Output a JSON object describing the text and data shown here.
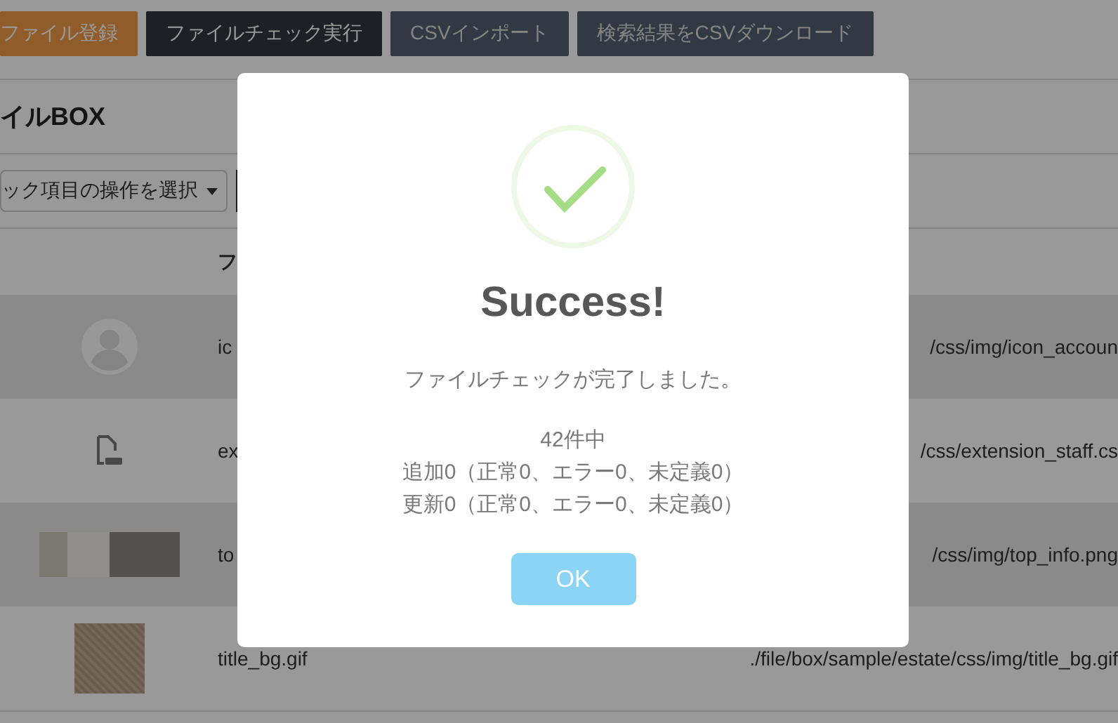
{
  "toolbar": {
    "buttons": [
      {
        "label": "ファイル登録",
        "kind": "accent"
      },
      {
        "label": "ファイルチェック実行",
        "kind": "dark"
      },
      {
        "label": "CSVインポート",
        "kind": "slate"
      },
      {
        "label": "検索結果をCSVダウンロード",
        "kind": "slate"
      }
    ]
  },
  "page_title": "イルBOX",
  "bulk_action": {
    "label": "ック項目の操作を選択"
  },
  "table": {
    "columns": [
      "フ"
    ],
    "rows": [
      {
        "kind": "avatar",
        "name": "ic",
        "path": "/css/img/icon_accoun"
      },
      {
        "kind": "css-file",
        "name": "ex",
        "path": "/css/extension_staff.cs"
      },
      {
        "kind": "photo",
        "name": "to",
        "path": "/css/img/top_info.png"
      },
      {
        "kind": "texture",
        "name": "title_bg.gif",
        "path": "./file/box/sample/estate/css/img/title_bg.gif"
      }
    ]
  },
  "dialog": {
    "title": "Success!",
    "message": "ファイルチェックが完了しました。",
    "details": [
      "42件中",
      "追加0（正常0、エラー0、未定義0）",
      "更新0（正常0、エラー0、未定義0）"
    ],
    "button": "OK"
  }
}
